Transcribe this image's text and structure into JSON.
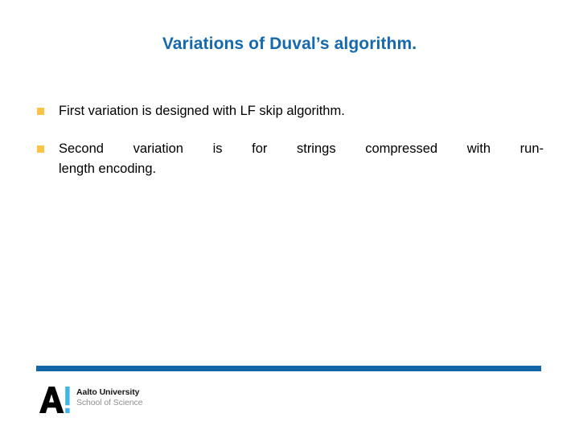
{
  "slide": {
    "title": "Variations of Duval’s algorithm.",
    "title_color": "#1669ad",
    "background_color": "#ffffff",
    "bullet_marker_color": "#fbc347",
    "body": [
      {
        "marker": "square-bullet",
        "text": "First variation is designed with LF skip algorithm.",
        "justified": false,
        "lines": [
          "First variation is designed with LF skip algorithm."
        ]
      },
      {
        "marker": "square-bullet",
        "text": "Second variation is for strings compressed with run-length encoding.",
        "justified": true,
        "lines": [
          "Second variation is for strings compressed with run-",
          "length encoding."
        ]
      }
    ]
  },
  "footer": {
    "rule_color": "#1167a8",
    "logo": {
      "mark_letter": "A",
      "mark_accent": "!",
      "mark_letter_color": "#000000",
      "mark_accent_color": "#3fb6e8",
      "organization": "Aalto University",
      "unit": "School of Science"
    }
  }
}
